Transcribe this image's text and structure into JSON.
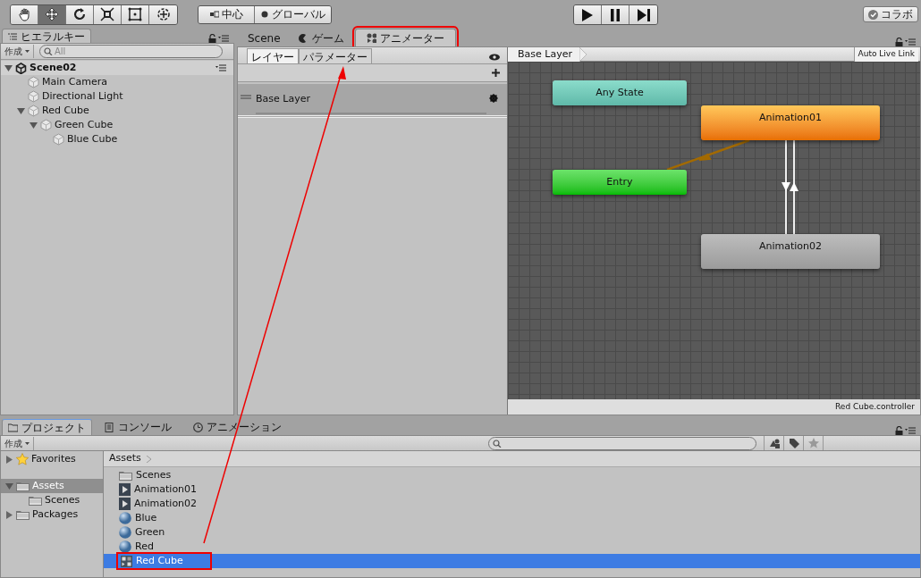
{
  "toolbar": {
    "tools": [
      {
        "kind": "hand",
        "selected": false
      },
      {
        "kind": "move",
        "selected": true
      },
      {
        "kind": "rotate",
        "selected": false
      },
      {
        "kind": "scale",
        "selected": false
      },
      {
        "kind": "rect",
        "selected": false
      },
      {
        "kind": "transform",
        "selected": false
      }
    ],
    "pivot": [
      "中心",
      "グローバル"
    ],
    "play": [
      {
        "kind": "play"
      },
      {
        "kind": "pause"
      },
      {
        "kind": "step"
      }
    ],
    "collab": "コラボ"
  },
  "hierarchy": {
    "tab": "ヒエラルキー",
    "create": "作成",
    "search_placeholder": "All",
    "tree": [
      {
        "label": "Scene02",
        "kind": "scene",
        "expanded": true,
        "children": [
          {
            "label": "Main Camera",
            "kind": "object"
          },
          {
            "label": "Directional Light",
            "kind": "object"
          },
          {
            "label": "Red Cube",
            "kind": "object",
            "expanded": true,
            "children": [
              {
                "label": "Green Cube",
                "kind": "object",
                "expanded": true,
                "children": [
                  {
                    "label": "Blue Cube",
                    "kind": "object"
                  }
                ]
              }
            ]
          }
        ]
      }
    ]
  },
  "center_tabs": [
    {
      "label": "Scene",
      "kind": "scene",
      "selected": false,
      "highlighted": false
    },
    {
      "label": "ゲーム",
      "kind": "game",
      "selected": false,
      "highlighted": false
    },
    {
      "label": "アニメーター",
      "kind": "animator",
      "selected": true,
      "highlighted": true
    }
  ],
  "animator": {
    "side_tabs": [
      {
        "label": "レイヤー",
        "selected": true
      },
      {
        "label": "パラメーター",
        "selected": false
      }
    ],
    "layers": [
      {
        "label": "Base Layer"
      }
    ],
    "breadcrumb": "Base Layer",
    "live_link": "Auto Live Link",
    "states": [
      {
        "label": "Any State",
        "kind": "any"
      },
      {
        "label": "Animation01",
        "kind": "default"
      },
      {
        "label": "Entry",
        "kind": "entry"
      },
      {
        "label": "Animation02",
        "kind": "normal"
      }
    ],
    "footer": "Red Cube.controller"
  },
  "bottom_tabs": [
    {
      "label": "プロジェクト",
      "kind": "project",
      "selected": true
    },
    {
      "label": "コンソール",
      "kind": "console",
      "selected": false
    },
    {
      "label": "アニメーション",
      "kind": "animation",
      "selected": false
    }
  ],
  "project": {
    "create": "作成",
    "folders": [
      {
        "label": "Favorites",
        "kind": "favorites",
        "expanded": false,
        "selected": false
      },
      {
        "label": "Assets",
        "kind": "folder",
        "expanded": true,
        "selected": true,
        "children": [
          {
            "label": "Scenes",
            "kind": "folder",
            "selected": false
          }
        ]
      },
      {
        "label": "Packages",
        "kind": "folder",
        "expanded": false,
        "selected": false
      }
    ],
    "breadcrumb": "Assets",
    "assets": [
      {
        "label": "Scenes",
        "kind": "folder",
        "selected": false,
        "highlighted": false
      },
      {
        "label": "Animation01",
        "kind": "clip",
        "selected": false,
        "highlighted": false
      },
      {
        "label": "Animation02",
        "kind": "clip",
        "selected": false,
        "highlighted": false
      },
      {
        "label": "Blue",
        "kind": "material",
        "selected": false,
        "highlighted": false
      },
      {
        "label": "Green",
        "kind": "material",
        "selected": false,
        "highlighted": false
      },
      {
        "label": "Red",
        "kind": "material",
        "selected": false,
        "highlighted": false
      },
      {
        "label": "Red Cube",
        "kind": "controller",
        "selected": true,
        "highlighted": true
      }
    ]
  }
}
